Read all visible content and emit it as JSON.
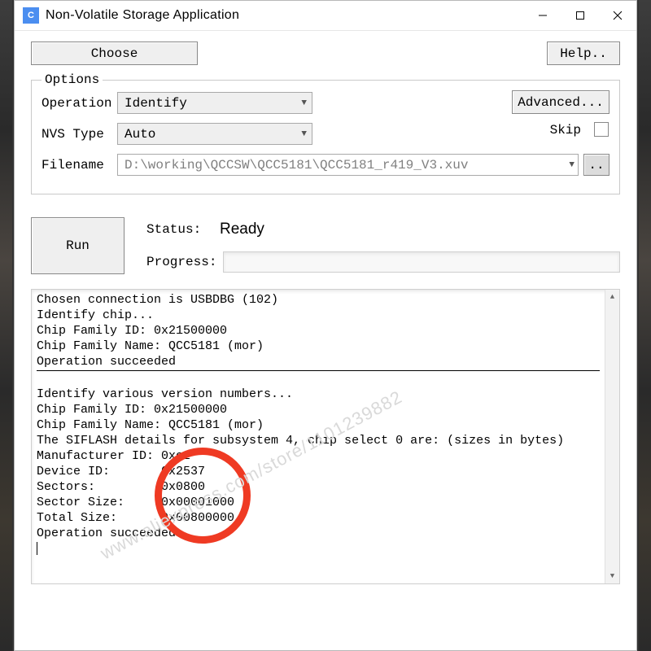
{
  "window": {
    "title": "Non-Volatile Storage Application",
    "icon_letter": "C"
  },
  "buttons": {
    "choose": "Choose",
    "help": "Help..",
    "advanced": "Advanced...",
    "run": "Run",
    "browse": ".."
  },
  "options": {
    "legend": "Options",
    "operation_label": "Operation",
    "operation_value": "Identify",
    "nvs_label": "NVS Type",
    "nvs_value": "Auto",
    "filename_label": "Filename",
    "filename_value": "D:\\working\\QCCSW\\QCC5181\\QCC5181_r419_V3.xuv",
    "skip_label": "Skip"
  },
  "status": {
    "status_label": "Status:",
    "status_value": "Ready",
    "progress_label": "Progress:"
  },
  "log": {
    "block1": "Chosen connection is USBDBG (102)\nIdentify chip...\nChip Family ID: 0x21500000\nChip Family Name: QCC5181 (mor)\nOperation succeeded",
    "block2": "Identify various version numbers...\nChip Family ID: 0x21500000\nChip Family Name: QCC5181 (mor)\nThe SIFLASH details for subsystem 4, chip select 0 are: (sizes in bytes)\nManufacturer ID: 0xc2\nDevice ID:       0x2537\nSectors:         0x0800\nSector Size:     0x00001000\nTotal Size:      0x00800000\nOperation succeeded"
  },
  "watermark": "www.aliexpress.com/store/1101239882"
}
